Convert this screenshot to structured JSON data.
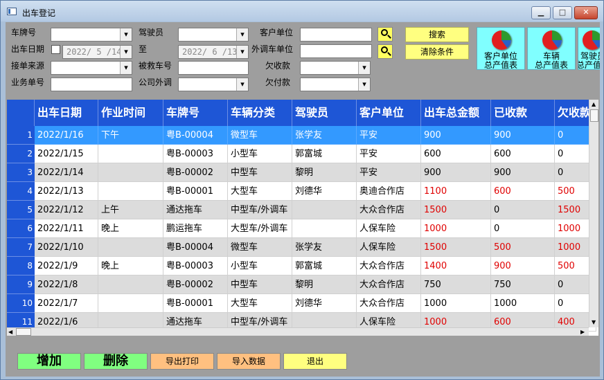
{
  "window": {
    "title": "出车登记",
    "btn_min": "▁",
    "btn_max": "□",
    "btn_close": "✕"
  },
  "filters": {
    "plate_label": "车牌号",
    "driver_label": "驾驶员",
    "customer_label": "客户单位",
    "date_label": "出车日期",
    "date_from": "2022/ 5 /14",
    "date_to_label": "至",
    "date_to": "2022/ 6 /13",
    "outsource_label": "外调车单位",
    "source_label": "接单来源",
    "rescued_label": "被救车号",
    "owed_label": "欠收款",
    "order_label": "业务单号",
    "company_outsource_label": "公司外调",
    "payable_label": "欠付款"
  },
  "buttons": {
    "search": "搜索",
    "clear": "清除条件",
    "customer_report": [
      "客户单位",
      "总产值表"
    ],
    "vehicle_report": [
      "车辆",
      "总产值表"
    ],
    "driver_report": [
      "驾驶员",
      "总产值表"
    ],
    "add": "增加",
    "delete": "删除",
    "export": "导出打印",
    "import": "导入数据",
    "exit": "退出"
  },
  "table": {
    "columns": [
      "出车日期",
      "作业时间",
      "车牌号",
      "车辆分类",
      "驾驶员",
      "客户单位",
      "出车总金额",
      "已收款",
      "欠收款"
    ],
    "rows": [
      [
        "2022/1/16",
        "下午",
        "粤B-00004",
        "微型车",
        "张学友",
        "平安",
        "900",
        "900",
        "0"
      ],
      [
        "2022/1/15",
        "",
        "粤B-00003",
        "小型车",
        "郭富城",
        "平安",
        "600",
        "600",
        "0"
      ],
      [
        "2022/1/14",
        "",
        "粤B-00002",
        "中型车",
        "黎明",
        "平安",
        "900",
        "900",
        "0"
      ],
      [
        "2022/1/13",
        "",
        "粤B-00001",
        "大型车",
        "刘德华",
        "奥迪合作店",
        "1100",
        "600",
        "500"
      ],
      [
        "2022/1/12",
        "上午",
        "通达拖车",
        "中型车/外调车",
        "",
        "大众合作店",
        "1500",
        "0",
        "1500"
      ],
      [
        "2022/1/11",
        "晚上",
        "鹏运拖车",
        "大型车/外调车",
        "",
        "人保车险",
        "1000",
        "0",
        "1000"
      ],
      [
        "2022/1/10",
        "",
        "粤B-00004",
        "微型车",
        "张学友",
        "人保车险",
        "1500",
        "500",
        "1000"
      ],
      [
        "2022/1/9",
        "晚上",
        "粤B-00003",
        "小型车",
        "郭富城",
        "大众合作店",
        "1400",
        "900",
        "500"
      ],
      [
        "2022/1/8",
        "",
        "粤B-00002",
        "中型车",
        "黎明",
        "大众合作店",
        "750",
        "750",
        "0"
      ],
      [
        "2022/1/7",
        "",
        "粤B-00001",
        "大型车",
        "刘德华",
        "大众合作店",
        "1000",
        "1000",
        "0"
      ],
      [
        "2022/1/6",
        "",
        "通达拖车",
        "中型车/外调车",
        "",
        "人保车险",
        "1000",
        "600",
        "400"
      ]
    ],
    "red_rows": [
      3,
      4,
      5,
      6,
      7,
      10
    ],
    "selected_row": 0,
    "selected_color": "#3399ff"
  }
}
